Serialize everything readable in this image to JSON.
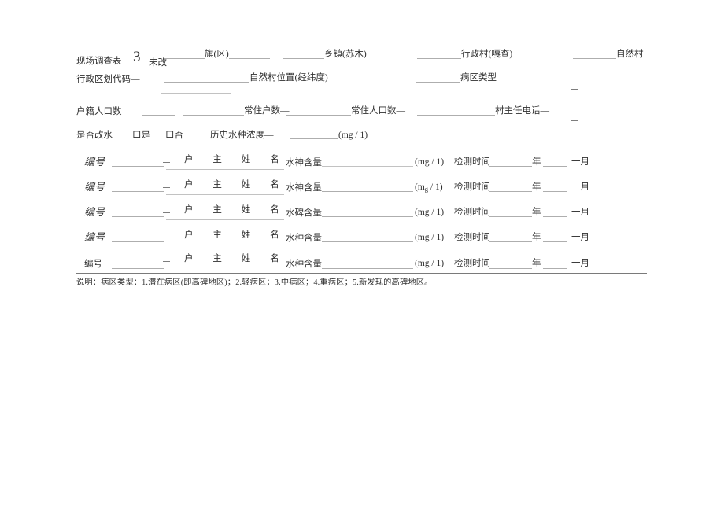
{
  "document": {
    "title_prefix": "现场调查表",
    "title_number": "3",
    "title_suffix": "未改",
    "header": {
      "line1": {
        "field_qu": "旗(区)",
        "field_xiangzhen": "乡镇(苏木)",
        "field_xingzhengcun": "行政村(嘎查)",
        "field_zirancun": "自然村"
      },
      "line2": {
        "label_code": "行政区划代码—",
        "field_position": "自然村位置(经纬度)",
        "field_bingqu": "病区类型"
      },
      "line3": {
        "label_hujiren": "户籍人口数",
        "field_changzhuhushu": "常住户数—",
        "field_changzhurenkou": "常住人口数—",
        "field_cunzhuren": "村主任电话—"
      },
      "line4": {
        "label_gaishui": "是否改水",
        "option_yes": "口是",
        "option_no": "口否",
        "label_lishi": "历史水种浓度—",
        "unit": "(mg / 1)"
      }
    },
    "rows": [
      {
        "no_label": "编号",
        "householder_label": "户 主 姓 名",
        "content_label": "水神含量",
        "unit": "(mg / 1)",
        "time_label": "检测时间",
        "year_label": "年",
        "month_label": "一月"
      },
      {
        "no_label": "编号",
        "householder_label": "户 主 姓 名",
        "content_label": "水神含量",
        "unit": "(mg / 1)",
        "unit_sub": true,
        "time_label": "检测时间",
        "year_label": "年",
        "month_label": "一月"
      },
      {
        "no_label": "编号",
        "householder_label": "户 主 姓 名",
        "content_label": "水碑含量",
        "unit": "(mg / 1)",
        "time_label": "检测时间",
        "year_label": "年",
        "month_label": "一月"
      },
      {
        "no_label": "编号",
        "householder_label": "户 主 姓 名",
        "content_label": "水种含量",
        "unit": "(mg / 1)",
        "time_label": "检测时间",
        "year_label": "年",
        "month_label": "一月"
      },
      {
        "no_label": "编号",
        "householder_label": "户 主 姓 名",
        "content_label": "水种含量",
        "unit": "(mg / 1)",
        "time_label": "检测时间",
        "year_label": "年",
        "month_label": "一月"
      }
    ],
    "footnote": "说明：病区类型：1.潜在病区(即高碑地区)；2.轻病区；3.中病区；4.重病区；5.新发现的高碑地区。"
  }
}
